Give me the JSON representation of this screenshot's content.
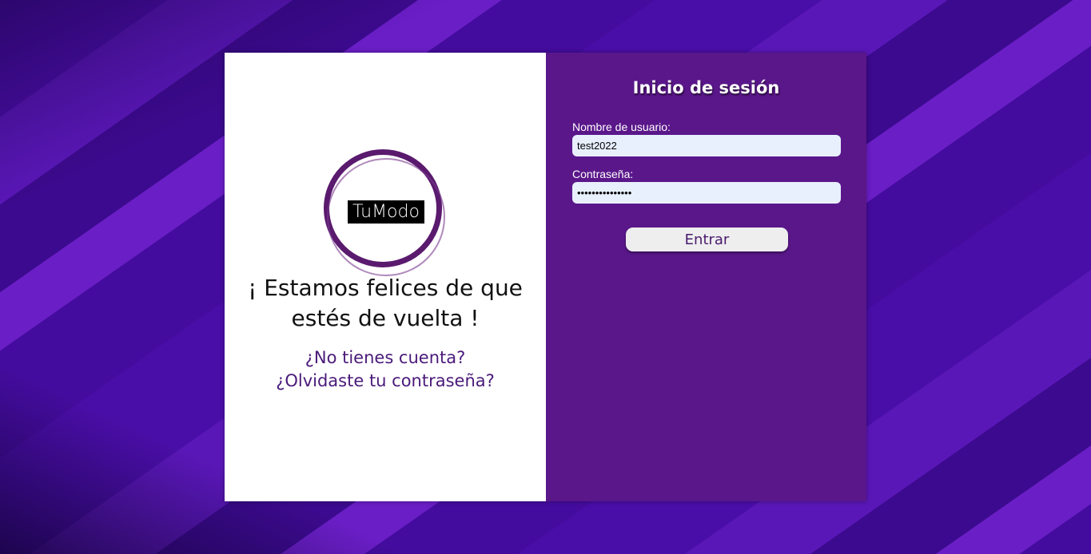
{
  "brand": {
    "logo_text": "TuModo"
  },
  "welcome": {
    "line1": "¡ Estamos felices de que",
    "line2": "estés de vuelta !"
  },
  "links": {
    "no_account": "¿No tienes cuenta?",
    "forgot_password": "¿Olvidaste tu contraseña?"
  },
  "login_form": {
    "title": "Inicio de sesión",
    "username_label": "Nombre de usuario:",
    "username_value": "test2022",
    "password_label": "Contraseña:",
    "password_value": "testpassword123",
    "submit_label": "Entrar"
  },
  "colors": {
    "background": "#3a0a94",
    "form_panel": "#5a178a",
    "link": "#4a1a7a",
    "input_bg": "#e8f0fe"
  }
}
